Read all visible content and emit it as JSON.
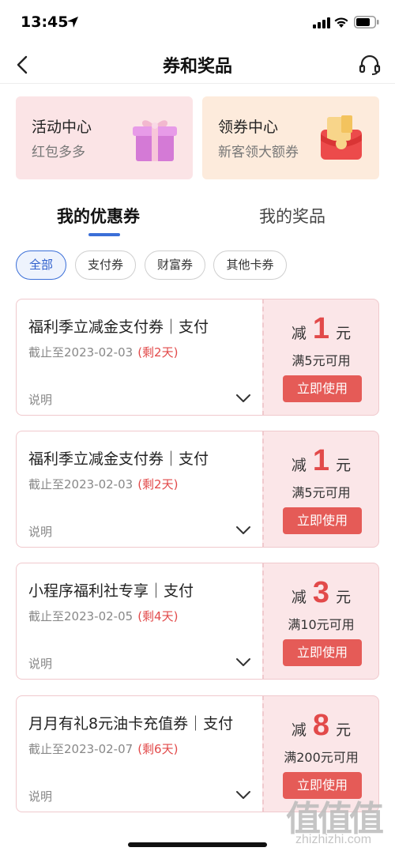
{
  "status_bar": {
    "time": "13:45",
    "icons": [
      "location-arrow-icon",
      "signal-icon",
      "wifi-icon",
      "battery-icon"
    ]
  },
  "nav": {
    "title": "券和奖品",
    "back_icon": "chevron-left-icon",
    "service_icon": "headset-icon"
  },
  "entries": [
    {
      "title": "活动中心",
      "subtitle": "红包多多",
      "icon": "gift-box-icon"
    },
    {
      "title": "领券中心",
      "subtitle": "新客领大额券",
      "icon": "red-envelope-icon"
    }
  ],
  "tabs": [
    {
      "label": "我的优惠券",
      "active": true
    },
    {
      "label": "我的奖品",
      "active": false
    }
  ],
  "filters": [
    {
      "label": "全部",
      "active": true
    },
    {
      "label": "支付券",
      "active": false
    },
    {
      "label": "财富券",
      "active": false
    },
    {
      "label": "其他卡券",
      "active": false
    }
  ],
  "coupons": [
    {
      "title": "福利季立减金支付券｜支付",
      "deadline": "截止至2023-02-03",
      "remaining": "(剩2天)",
      "desc": "说明",
      "amount_prefix": "减",
      "amount": "1",
      "amount_unit": "元",
      "condition": "满5元可用",
      "button": "立即使用"
    },
    {
      "title": "福利季立减金支付券｜支付",
      "deadline": "截止至2023-02-03",
      "remaining": "(剩2天)",
      "desc": "说明",
      "amount_prefix": "减",
      "amount": "1",
      "amount_unit": "元",
      "condition": "满5元可用",
      "button": "立即使用"
    },
    {
      "title": "小程序福利社专享｜支付",
      "deadline": "截止至2023-02-05",
      "remaining": "(剩4天)",
      "desc": "说明",
      "amount_prefix": "减",
      "amount": "3",
      "amount_unit": "元",
      "condition": "满10元可用",
      "button": "立即使用"
    },
    {
      "title": "月月有礼8元油卡充值券｜支付",
      "deadline": "截止至2023-02-07",
      "remaining": "(剩6天)",
      "desc": "说明",
      "amount_prefix": "减",
      "amount": "8",
      "amount_unit": "元",
      "condition": "满200元可用",
      "button": "立即使用"
    }
  ],
  "watermark": {
    "glyphs": "值值值",
    "domain": "zhizhizhi.com"
  },
  "colors": {
    "accent_blue": "#3b6fd8",
    "coupon_red": "#e24a4a",
    "button_red": "#e55b57",
    "coupon_pink_bg": "#fbe6e8"
  }
}
